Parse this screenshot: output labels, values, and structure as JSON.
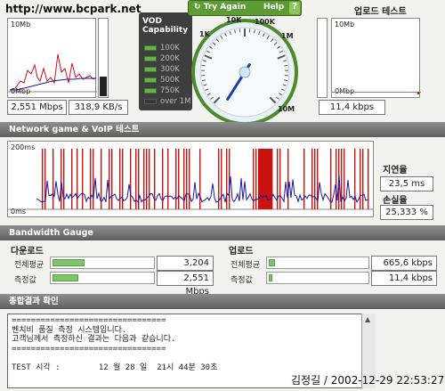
{
  "watermark": "http://www.bcpark.net",
  "download_panel": {
    "ymax": "10Mb",
    "ymin": "0Mbp",
    "speed_mbps": "2,551 Mbps",
    "speed_kbs": "318,9 KB/s"
  },
  "vod": {
    "title": "VOD Capability",
    "levels": [
      "100K",
      "200K",
      "300K",
      "500K",
      "750K",
      "over 1M"
    ]
  },
  "dial": {
    "try_again": "Try Again",
    "help": "Help",
    "help_icon": "?",
    "ticks": [
      "1K",
      "10K",
      "100K",
      "1M",
      "10M"
    ],
    "needle_fraction": 0.62
  },
  "upload_panel": {
    "title": "업로드 테스트",
    "ymax": "10Mb",
    "ymin": "0Mbp",
    "speed": "11,4 kbps"
  },
  "network": {
    "header": "Network game & VoIP 테스트",
    "ymax": "200ms",
    "ymin": "0ms",
    "latency_label": "지연율",
    "latency_value": "23,5 ms",
    "loss_label": "손실율",
    "loss_value": "25,333 %"
  },
  "bandwidth": {
    "header": "Bandwidth Gauge",
    "download": {
      "title": "다운로드",
      "avg_label": "전체평균",
      "avg_value": "3,204 Mbps",
      "avg_fraction": 0.32,
      "cur_label": "측정값",
      "cur_value": "2,551 Mbps",
      "cur_fraction": 0.26
    },
    "upload": {
      "title": "업로드",
      "avg_label": "전체평균",
      "avg_value": "665,6 kbps",
      "avg_fraction": 0.06,
      "cur_label": "측정값",
      "cur_value": "11,4 kbps",
      "cur_fraction": 0.02
    }
  },
  "summary": {
    "header": "종합결과 확인",
    "text": "================================\n벤치비 품질 측정 시스템입니다.\n고객님께서 측정하신 결과는 다음과 같습니다.\n================================\n\nTEST 시각 :        12 월 28 일  21시 44분 30초"
  },
  "signature": "김정길 / 2002-12-29 22:53:27",
  "colors": {
    "accent_green": "#5e9b35",
    "graph_red": "#cc1111",
    "graph_blue": "#1a1aa0"
  }
}
